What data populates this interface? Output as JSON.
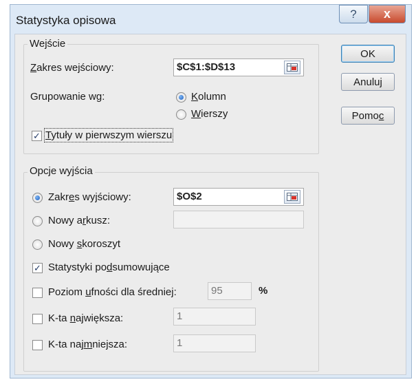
{
  "dialog": {
    "title": "Statystyka opisowa",
    "help_glyph": "?",
    "close_glyph": "x"
  },
  "input_group": {
    "label": "Wejście",
    "range_label_u": "Z",
    "range_label_rest": "akres wejściowy:",
    "range_value": "$C$1:$D$13",
    "grouping_label": "Grupowanie wg:",
    "columns_u": "K",
    "columns_rest": "olumn",
    "rows_u": "W",
    "rows_rest": "ierszy",
    "titles_u": "T",
    "titles_rest": "ytuły w pierwszym wierszu",
    "titles_checked": true,
    "grouping_selected": "columns"
  },
  "output_group": {
    "label": "Opcje wyjścia",
    "output_range_a": "Zakr",
    "output_range_u": "e",
    "output_range_b": "s wyjściowy:",
    "output_range_value": "$O$2",
    "new_sheet_a": "Nowy a",
    "new_sheet_u": "r",
    "new_sheet_b": "kusz:",
    "new_workbook_a": "Nowy ",
    "new_workbook_u": "s",
    "new_workbook_b": "koroszyt",
    "summary_a": "Statystyki po",
    "summary_u": "d",
    "summary_b": "sumowujące",
    "summary_checked": true,
    "confidence_a": "Poziom ",
    "confidence_u": "u",
    "confidence_b": "fności dla średniej:",
    "confidence_value": "95",
    "confidence_unit": "%",
    "kth_largest_a": "K-ta ",
    "kth_largest_u": "n",
    "kth_largest_b": "ajwiększa:",
    "kth_largest_value": "1",
    "kth_smallest_a": "K-ta naj",
    "kth_smallest_u": "m",
    "kth_smallest_b": "niejsza:",
    "kth_smallest_value": "1",
    "output_selected": "output_range"
  },
  "buttons": {
    "ok": "OK",
    "cancel": "Anuluj",
    "help_a": "Pomo",
    "help_u": "c"
  },
  "icons": {
    "range_picker": "range-select-icon",
    "help": "question-icon",
    "close": "close-icon"
  },
  "colors": {
    "title_bar": "#dde9f6",
    "close_button": "#c84a2e",
    "radio_selected": "#1d5fbf"
  }
}
